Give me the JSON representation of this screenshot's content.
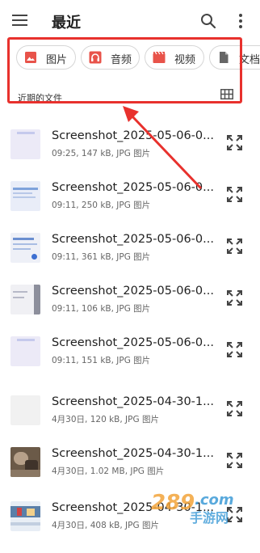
{
  "appbar": {
    "title": "最近",
    "menu_icon": "hamburger-menu-icon",
    "search_icon": "search-icon",
    "more_icon": "more-vert-icon"
  },
  "chips": [
    {
      "label": "图片",
      "icon": "image-icon",
      "color": "#e8534a"
    },
    {
      "label": "音频",
      "icon": "headphones-icon",
      "color": "#e8534a"
    },
    {
      "label": "视频",
      "icon": "movie-icon",
      "color": "#e8534a"
    },
    {
      "label": "文档",
      "icon": "document-icon",
      "color": "#666666"
    }
  ],
  "section": {
    "label": "近期的文件",
    "view_toggle_icon": "grid-view-icon"
  },
  "files": [
    {
      "name": "Screenshot_2025-05-06-0...",
      "meta": "09:25, 147 kB, JPG 图片"
    },
    {
      "name": "Screenshot_2025-05-06-0...",
      "meta": "09:11, 250 kB, JPG 图片"
    },
    {
      "name": "Screenshot_2025-05-06-0...",
      "meta": "09:11, 361 kB, JPG 图片"
    },
    {
      "name": "Screenshot_2025-05-06-0...",
      "meta": "09:11, 106 kB, JPG 图片"
    },
    {
      "name": "Screenshot_2025-05-06-0...",
      "meta": "09:11, 151 kB, JPG 图片"
    },
    {
      "name": "Screenshot_2025-04-30-1...",
      "meta": "4月30日, 120 kB, JPG 图片"
    },
    {
      "name": "Screenshot_2025-04-30-1...",
      "meta": "4月30日, 1.02 MB, JPG 图片"
    },
    {
      "name": "Screenshot_2025-04-30-1...",
      "meta": "4月30日, 408 kB, JPG 图片"
    }
  ],
  "watermark": {
    "brand": "289.com",
    "tagline": "手游网"
  },
  "colors": {
    "annotation": "#e8312d",
    "accent": "#e8534a"
  }
}
